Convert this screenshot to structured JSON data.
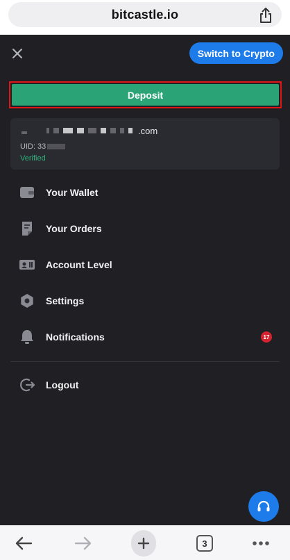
{
  "browser": {
    "url": "bitcastle.io",
    "tab_count": "3"
  },
  "header": {
    "switch_label": "Switch to Crypto"
  },
  "deposit_label": "Deposit",
  "account": {
    "email_suffix": ".com",
    "uid_prefix": "UID: 33",
    "status": "Verified"
  },
  "menu": {
    "items": [
      {
        "label": "Your Wallet",
        "icon": "wallet-icon"
      },
      {
        "label": "Your Orders",
        "icon": "orders-icon"
      },
      {
        "label": "Account Level",
        "icon": "id-card-icon"
      },
      {
        "label": "Settings",
        "icon": "gear-icon"
      },
      {
        "label": "Notifications",
        "icon": "bell-icon",
        "badge": "17"
      }
    ],
    "logout_label": "Logout"
  },
  "colors": {
    "background": "#1f1f24",
    "card": "#2a2a31",
    "accent_blue": "#1d7ce9",
    "deposit_green": "#2aa477",
    "verified_green": "#2fb27a",
    "badge_red": "#d2232f",
    "highlight_border": "#e01515"
  }
}
